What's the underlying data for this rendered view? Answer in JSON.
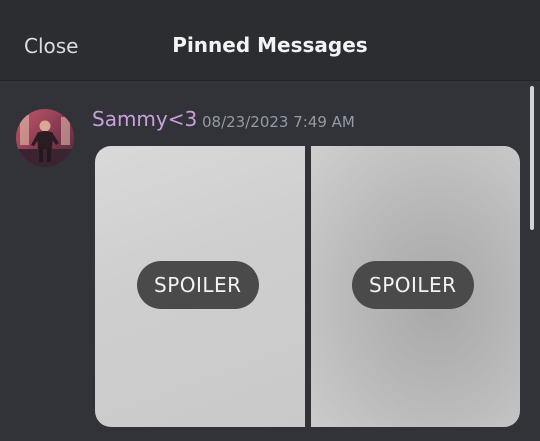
{
  "header": {
    "close_label": "Close",
    "title": "Pinned Messages"
  },
  "message": {
    "author": "Sammy<3",
    "timestamp": "08/23/2023 7:49 AM",
    "attachments": [
      {
        "label": "SPOILER"
      },
      {
        "label": "SPOILER"
      }
    ]
  },
  "colors": {
    "background": "#313338",
    "header_background": "#2b2d31",
    "username": "#c9a0dc",
    "timestamp": "#949ba4",
    "spoiler_pill": "#4a4a4a"
  }
}
